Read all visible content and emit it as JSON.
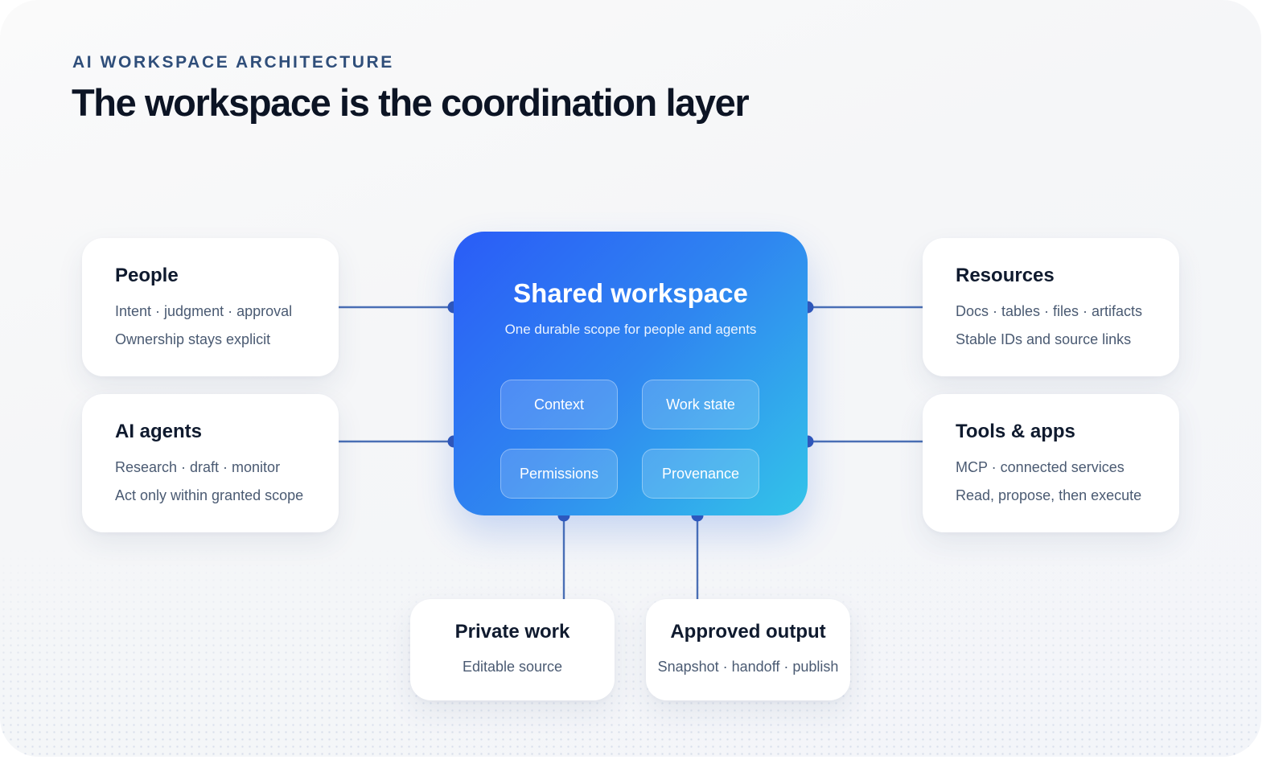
{
  "header": {
    "eyebrow": "AI WORKSPACE ARCHITECTURE",
    "title": "The workspace is the coordination layer"
  },
  "hub": {
    "title": "Shared workspace",
    "subtitle": "One durable scope for people and agents",
    "chips": [
      "Context",
      "Work state",
      "Permissions",
      "Provenance"
    ]
  },
  "nodes": {
    "people": {
      "title": "People",
      "line1": "Intent · judgment · approval",
      "line2": "Ownership stays explicit"
    },
    "agents": {
      "title": "AI agents",
      "line1": "Research · draft · monitor",
      "line2": "Act only within granted scope"
    },
    "resources": {
      "title": "Resources",
      "line1": "Docs · tables · files · artifacts",
      "line2": "Stable IDs and source links"
    },
    "tools": {
      "title": "Tools & apps",
      "line1": "MCP · connected services",
      "line2": "Read, propose, then execute"
    },
    "private_work": {
      "title": "Private work",
      "line1": "Editable source"
    },
    "approved_output": {
      "title": "Approved output",
      "line1": "Snapshot · handoff · publish"
    }
  },
  "colors": {
    "connector": "#4a6fb5",
    "connector_dot": "#2f56b8",
    "hub_gradient_start": "#2a5cf7",
    "hub_gradient_end": "#33c4e9",
    "eyebrow": "#2f4e7a",
    "title": "#0c1424"
  }
}
